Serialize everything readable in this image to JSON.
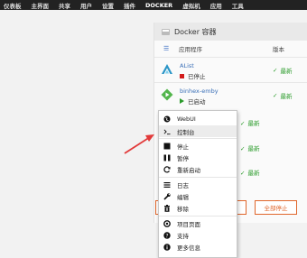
{
  "nav": {
    "items": [
      "仪表板",
      "主界面",
      "共享",
      "用户",
      "设置",
      "插件",
      "DOCKER",
      "虚拟机",
      "应用",
      "工具"
    ],
    "active_index": 6
  },
  "panel": {
    "title": "Docker 容器",
    "col_app": "应用程序",
    "col_version": "版本"
  },
  "containers": [
    {
      "name": "AList",
      "status": "已停止",
      "state": "stopped",
      "version": "最新"
    },
    {
      "name": "binhex-emby",
      "status": "已启动",
      "state": "started",
      "version": "最新"
    }
  ],
  "ghost_versions": [
    "最新",
    "最新",
    "最新"
  ],
  "buttons": {
    "stop_all": "全部停止"
  },
  "menu": {
    "items": [
      {
        "label": "WebUI",
        "icon": "globe-icon"
      },
      {
        "label": "控制台",
        "icon": "terminal-icon"
      },
      {
        "label": "停止",
        "icon": "stop-icon"
      },
      {
        "label": "暂停",
        "icon": "pause-icon"
      },
      {
        "label": "重新启动",
        "icon": "restart-icon"
      },
      {
        "label": "日志",
        "icon": "logs-icon"
      },
      {
        "label": "编辑",
        "icon": "wrench-icon"
      },
      {
        "label": "移除",
        "icon": "trash-icon"
      },
      {
        "label": "项目页面",
        "icon": "lifebuoy-icon"
      },
      {
        "label": "支持",
        "icon": "question-icon"
      },
      {
        "label": "更多信息",
        "icon": "info-icon"
      }
    ],
    "highlighted_index": 1
  },
  "colors": {
    "accent_orange": "#e0662b",
    "ok_green": "#2a9b2a",
    "stop_red": "#d21b1b",
    "link_blue": "#3a6fb7",
    "arrow_red": "#e23a3a"
  }
}
